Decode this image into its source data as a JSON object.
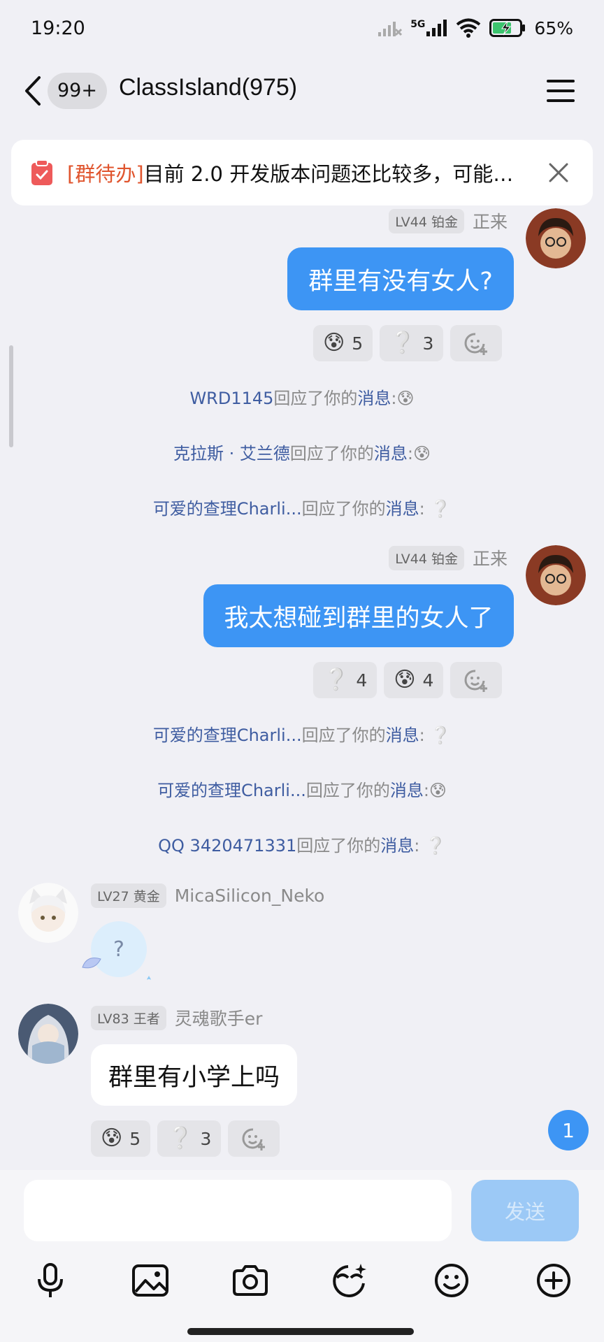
{
  "status_bar": {
    "time": "19:20",
    "network": "5G",
    "battery": "65%",
    "icons": [
      "signal-off-icon",
      "signal-5g-icon",
      "wifi-icon",
      "battery-charging-icon"
    ]
  },
  "header": {
    "unread_count": "99+",
    "title": "ClassIsland(975)",
    "icons": [
      "back-chevron-icon",
      "menu-icon"
    ]
  },
  "todo_banner": {
    "tag": "[群待办]",
    "text": "目前 2.0 开发版本问题还比较多，可能…",
    "icons": [
      "clipboard-check-icon",
      "close-icon"
    ]
  },
  "messages": [
    {
      "sender_level": "LV44 铂金",
      "sender_name": "正来",
      "text": "群里有没有女人?",
      "reactions": [
        {
          "emoji": "😰",
          "count": "5"
        },
        {
          "emoji": "❔",
          "count": "3"
        }
      ]
    },
    {
      "sender_level": "LV44 铂金",
      "sender_name": "正来",
      "text": "我太想碰到群里的女人了",
      "reactions": [
        {
          "emoji": "❔",
          "count": "4"
        },
        {
          "emoji": "😰",
          "count": "4"
        }
      ]
    },
    {
      "sender_level": "LV27 黄金",
      "sender_name": "MicaSilicon_Neko",
      "sticker_text": "?"
    },
    {
      "sender_level": "LV83 王者",
      "sender_name": "灵魂歌手er",
      "text": "群里有小学上吗",
      "reactions": [
        {
          "emoji": "😰",
          "count": "5"
        },
        {
          "emoji": "❔",
          "count": "3"
        }
      ]
    }
  ],
  "notices": [
    {
      "who": "WRD1145",
      "mid": "回应了你的",
      "msg": "消息",
      "tail": ":😰"
    },
    {
      "who": "克拉斯 · 艾兰德",
      "mid": "回应了你的",
      "msg": "消息",
      "tail": ":😰"
    },
    {
      "who": "可爱的查理Charli...",
      "mid": "回应了你的",
      "msg": "消息",
      "tail": ": ❔"
    },
    {
      "who": "可爱的查理Charli...",
      "mid": "回应了你的",
      "msg": "消息",
      "tail": ": ❔"
    },
    {
      "who": "可爱的查理Charli...",
      "mid": "回应了你的",
      "msg": "消息",
      "tail": ":😰"
    },
    {
      "who": "QQ 3420471331",
      "mid": "回应了你的",
      "msg": "消息",
      "tail": ": ❔"
    }
  ],
  "new_message_count": "1",
  "composer": {
    "input_value": "",
    "send_label": "发送",
    "tools": [
      "microphone-icon",
      "image-icon",
      "camera-icon",
      "sticker-icon",
      "emoji-icon",
      "plus-icon"
    ]
  },
  "colors": {
    "accent_blue": "#3d95f4",
    "todo_tag": "#e0552e",
    "notice_link": "#3f5da1"
  }
}
